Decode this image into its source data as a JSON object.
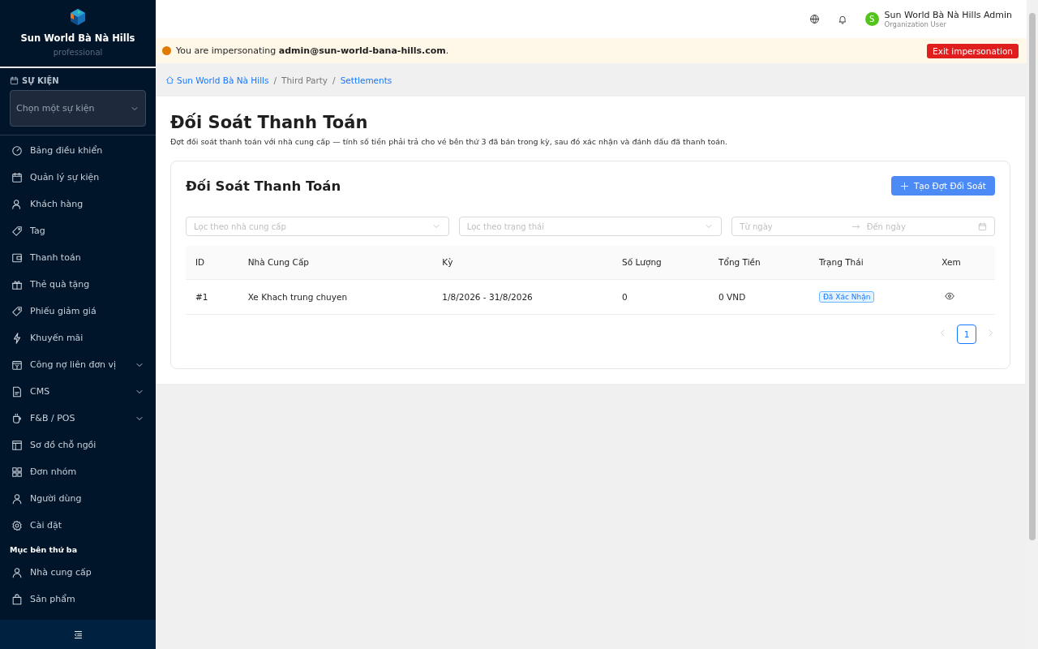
{
  "sidebar": {
    "brand": "Sun World Bà Nà Hills",
    "plan": "professional",
    "event_label": "SỰ KIỆN",
    "event_select": {
      "placeholder": "Chọn một sự kiện"
    },
    "groups": [
      {
        "items": [
          {
            "label": "Bảng điều khiển",
            "kind": "link"
          },
          {
            "label": "Quản lý sự kiện",
            "kind": "link"
          },
          {
            "label": "Khách hàng",
            "kind": "link"
          },
          {
            "label": "Tag",
            "kind": "link"
          },
          {
            "label": "Thanh toán",
            "kind": "link"
          },
          {
            "label": "Thẻ quà tặng",
            "kind": "link"
          },
          {
            "label": "Phiếu giảm giá",
            "kind": "link"
          },
          {
            "label": "Khuyến mãi",
            "kind": "link"
          },
          {
            "label": "Công nợ liên đơn vị",
            "kind": "submenu"
          },
          {
            "label": "CMS",
            "kind": "submenu"
          },
          {
            "label": "F&B / POS",
            "kind": "submenu"
          },
          {
            "label": "Sơ đồ chỗ ngồi",
            "kind": "link"
          },
          {
            "label": "Đơn nhóm",
            "kind": "link"
          },
          {
            "label": "Người dùng",
            "kind": "link"
          },
          {
            "label": "Cài đặt",
            "kind": "link"
          }
        ]
      },
      {
        "title": "Mục bên thứ ba",
        "items": [
          {
            "label": "Nhà cung cấp",
            "kind": "link"
          },
          {
            "label": "Sản phẩm",
            "kind": "link"
          }
        ]
      }
    ]
  },
  "header": {
    "user": {
      "initial": "S",
      "name": "Sun World Bà Nà Hills Admin",
      "role": "Organization User"
    }
  },
  "banner": {
    "text": "You are impersonating **admin@sun-world-bana-hills.com**.",
    "button": "Exit impersonation"
  },
  "breadcrumb": [
    {
      "label": "Sun World Bà Nà Hills",
      "kind": "home"
    },
    {
      "separator": "/",
      "label": "Third Party",
      "kind": "plain"
    },
    {
      "separator": "/",
      "label": "Settlements",
      "kind": "link"
    }
  ],
  "page": {
    "title": "Đối Soát Thanh Toán",
    "description": "Đợt đối soát thanh toán với nhà cung cấp — tính số tiền phải trả cho vé bên thứ 3 đã bán trong kỳ, sau đó xác nhận và đánh dấu đã thanh toán."
  },
  "card": {
    "title": "Đối Soát Thanh Toán",
    "create_button": "Tạo Đợt Đối Soát",
    "filters": {
      "supplier_placeholder": "Lọc theo nhà cung cấp",
      "status_placeholder": "Lọc theo trạng thái",
      "from_placeholder": "Từ ngày",
      "to_placeholder": "Đến ngày"
    },
    "table": {
      "columns": [
        "ID",
        "Nhà Cung Cấp",
        "Kỳ",
        "Số Lượng",
        "Tổng Tiền",
        "Trạng Thái",
        "Xem"
      ],
      "rows": [
        {
          "id": "#1",
          "supplier": "Xe Khach trung chuyen",
          "period": "1/8/2026 - 31/8/2026",
          "quantity": "0",
          "total": "0 VND",
          "status": "Đã Xác Nhận"
        }
      ]
    },
    "pagination": {
      "prev_disabled": true,
      "next_disabled": true,
      "pages": [
        {
          "label": "1",
          "selected": true
        }
      ]
    }
  }
}
